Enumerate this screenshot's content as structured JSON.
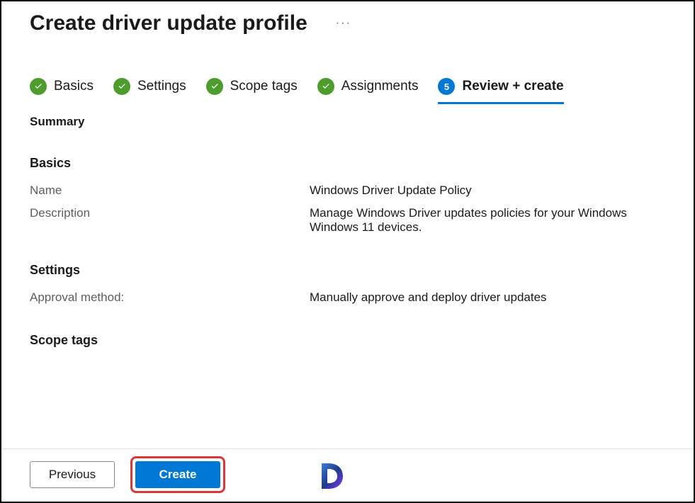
{
  "header": {
    "title": "Create driver update profile"
  },
  "steps": [
    {
      "label": "Basics",
      "status": "complete"
    },
    {
      "label": "Settings",
      "status": "complete"
    },
    {
      "label": "Scope tags",
      "status": "complete"
    },
    {
      "label": "Assignments",
      "status": "complete"
    },
    {
      "label": "Review + create",
      "status": "current",
      "number": "5"
    }
  ],
  "summary": {
    "heading": "Summary",
    "sections": {
      "basics": {
        "heading": "Basics",
        "fields": {
          "name_label": "Name",
          "name_value": "Windows Driver Update Policy",
          "description_label": "Description",
          "description_value": "Manage Windows Driver updates policies for your Windows Windows 11 devices."
        }
      },
      "settings": {
        "heading": "Settings",
        "fields": {
          "approval_label": "Approval method:",
          "approval_value": "Manually approve and deploy driver updates"
        }
      },
      "scope": {
        "heading": "Scope tags"
      }
    }
  },
  "footer": {
    "previous": "Previous",
    "create": "Create"
  }
}
